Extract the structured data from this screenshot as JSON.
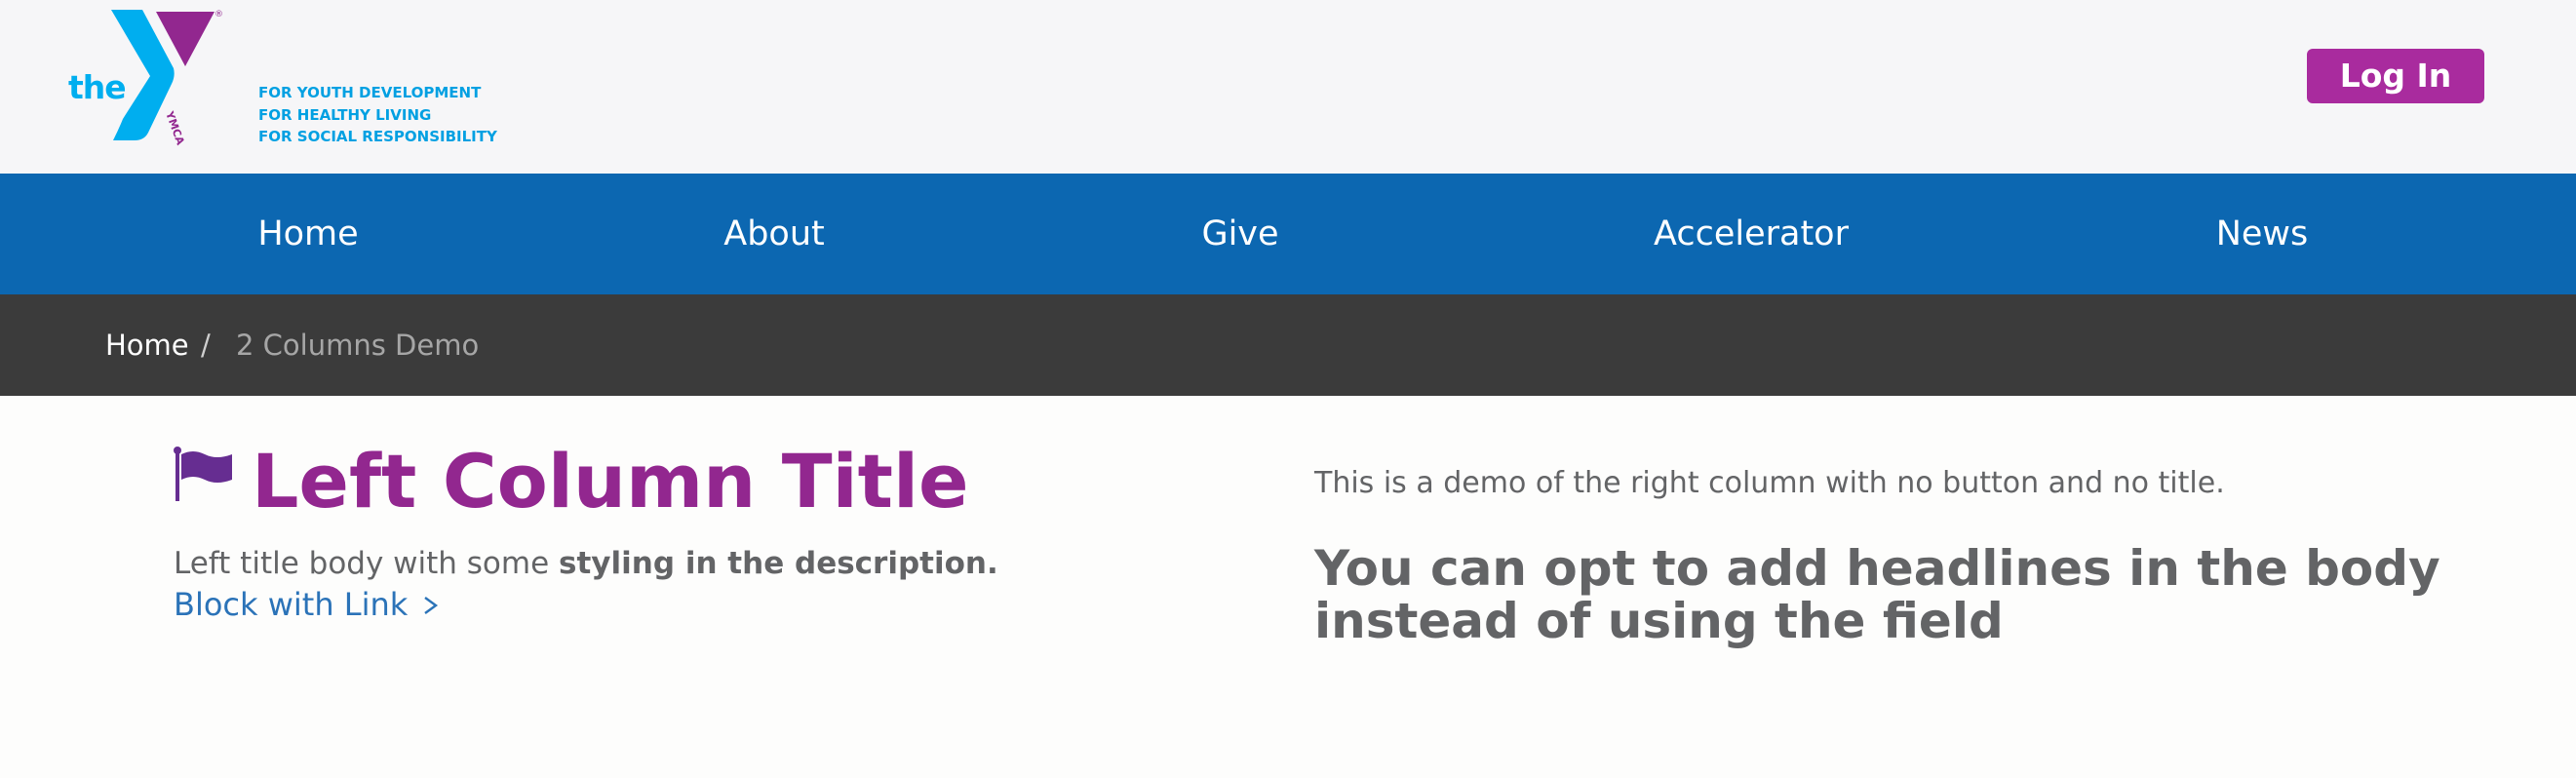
{
  "header": {
    "logo": {
      "wordmark": "the",
      "registered_mark": "®",
      "ymca_text": "YMCA",
      "tagline": [
        "FOR YOUTH DEVELOPMENT",
        "FOR HEALTHY LIVING",
        "FOR SOCIAL RESPONSIBILITY"
      ],
      "colors": {
        "blue": "#00aeef",
        "purple": "#92278f"
      }
    },
    "login_label": "Log In"
  },
  "nav": {
    "items": [
      {
        "label": "Home"
      },
      {
        "label": "About"
      },
      {
        "label": "Give"
      },
      {
        "label": "Accelerator"
      },
      {
        "label": "News"
      }
    ],
    "background": "#0c67b1"
  },
  "breadcrumb": {
    "home": "Home",
    "separator": "/",
    "current": "2 Columns Demo"
  },
  "left_column": {
    "icon": "flag-icon",
    "title": "Left Column Title",
    "body_plain": "Left title body with some ",
    "body_bold": "styling in the description.",
    "link_label": "Block with Link",
    "link_icon": "chevron-right-icon",
    "title_color": "#92278f",
    "link_color": "#2b73b8"
  },
  "right_column": {
    "intro": "This is a demo of the right column with no button and no title.",
    "headline": "You can opt to add headlines in the body instead of using the field"
  }
}
